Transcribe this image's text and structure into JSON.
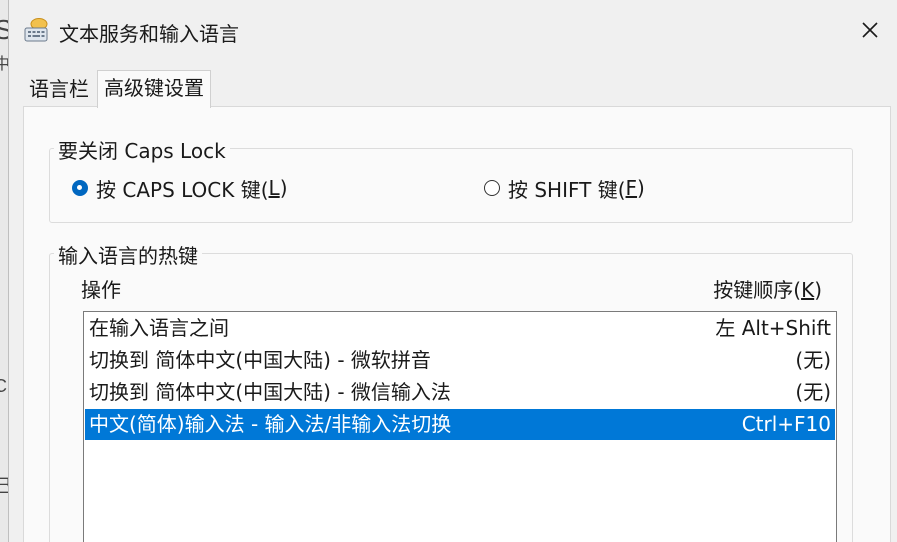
{
  "background": {
    "fragments": [
      "S",
      "中",
      "C",
      "己"
    ]
  },
  "window": {
    "title": "文本服务和输入语言",
    "icon": "keyboard-icon",
    "close": "close-icon"
  },
  "tabs": [
    {
      "label": "语言栏",
      "active": false
    },
    {
      "label": "高级键设置",
      "active": true
    }
  ],
  "caps_lock": {
    "legend": "要关闭 Caps Lock",
    "options": [
      {
        "label": "按 CAPS LOCK 键(",
        "mnemonic": "L",
        "suffix": ")",
        "checked": true
      },
      {
        "label": "按 SHIFT 键(",
        "mnemonic": "F",
        "suffix": ")",
        "checked": false
      }
    ]
  },
  "hotkeys": {
    "legend": "输入语言的热键",
    "col_action": "操作",
    "col_key_prefix": "按键顺序(",
    "col_key_mnemonic": "K",
    "col_key_suffix": ")",
    "rows": [
      {
        "action": "在输入语言之间",
        "key": "左 Alt+Shift",
        "selected": false
      },
      {
        "action": "切换到 简体中文(中国大陆) - 微软拼音",
        "key": "(无)",
        "selected": false
      },
      {
        "action": "切换到 简体中文(中国大陆) - 微信输入法",
        "key": "(无)",
        "selected": false
      },
      {
        "action": "中文(简体)输入法 - 输入法/非输入法切换",
        "key": "Ctrl+F10",
        "selected": true
      }
    ]
  },
  "colors": {
    "accent": "#0078d7",
    "radio_checked": "#0067c0"
  }
}
